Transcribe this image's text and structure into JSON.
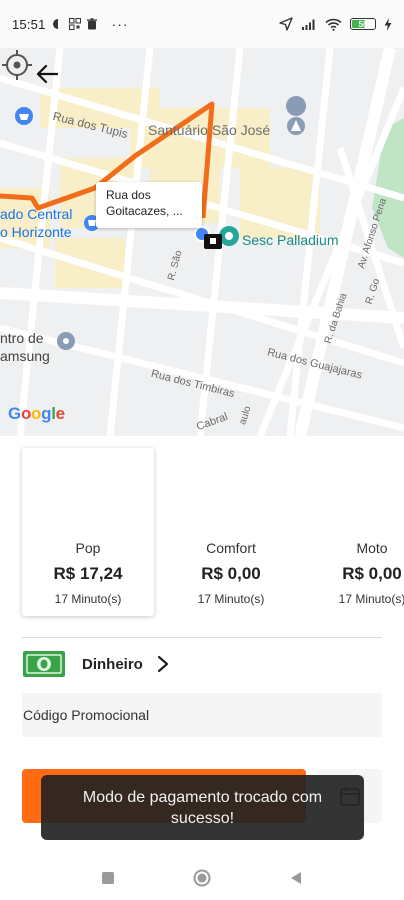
{
  "status_bar": {
    "time": "15:51",
    "dots": "···",
    "battery_level": "58",
    "icons": [
      "circle-icon",
      "qr-icon",
      "trash-icon",
      "location-arrow-icon",
      "signal-icon",
      "wifi-icon",
      "battery-icon",
      "charging-icon"
    ]
  },
  "map": {
    "labels": {
      "rua_dos_tupis": "Rua dos Tupis",
      "santuario": "Santuário São José",
      "mercado_line1": "ado Central",
      "mercado_line2": "o Horizonte",
      "sesc": "Sesc Palladium",
      "r_sao": "R. São",
      "centro_line1": "ntro de",
      "centro_line2": "amsung",
      "rua_guajajaras": "Rua dos Guajajaras",
      "rua_timbiras": "Rua dos Timbiras",
      "r_da_bahia": "R. da Bahia",
      "av_afonso_pena": "Av. Afonso Pena",
      "r_go": "R. Go",
      "cabral": "Cabral",
      "paulo": "aulo"
    },
    "address_bubble": {
      "line1": "Rua dos",
      "line2": "Goitacazes, ..."
    },
    "google_logo": "Google",
    "route_color": "#f26d1a"
  },
  "ride_options": [
    {
      "name": "Pop",
      "price": "R$ 17,24",
      "time": "17 Minuto(s)",
      "selected": true
    },
    {
      "name": "Comfort",
      "price": "R$ 0,00",
      "time": "17 Minuto(s)",
      "selected": false
    },
    {
      "name": "Moto",
      "price": "R$ 0,00",
      "time": "17 Minuto(s)",
      "selected": false
    }
  ],
  "payment": {
    "method": "Dinheiro",
    "icon": "cash-icon"
  },
  "promo": {
    "label": "Código Promocional"
  },
  "toast": {
    "message": "Modo de pagamento trocado com sucesso!"
  },
  "colors": {
    "accent": "#ff6a13",
    "cash_green": "#3aa34a",
    "poi_teal": "#1a8a85"
  }
}
